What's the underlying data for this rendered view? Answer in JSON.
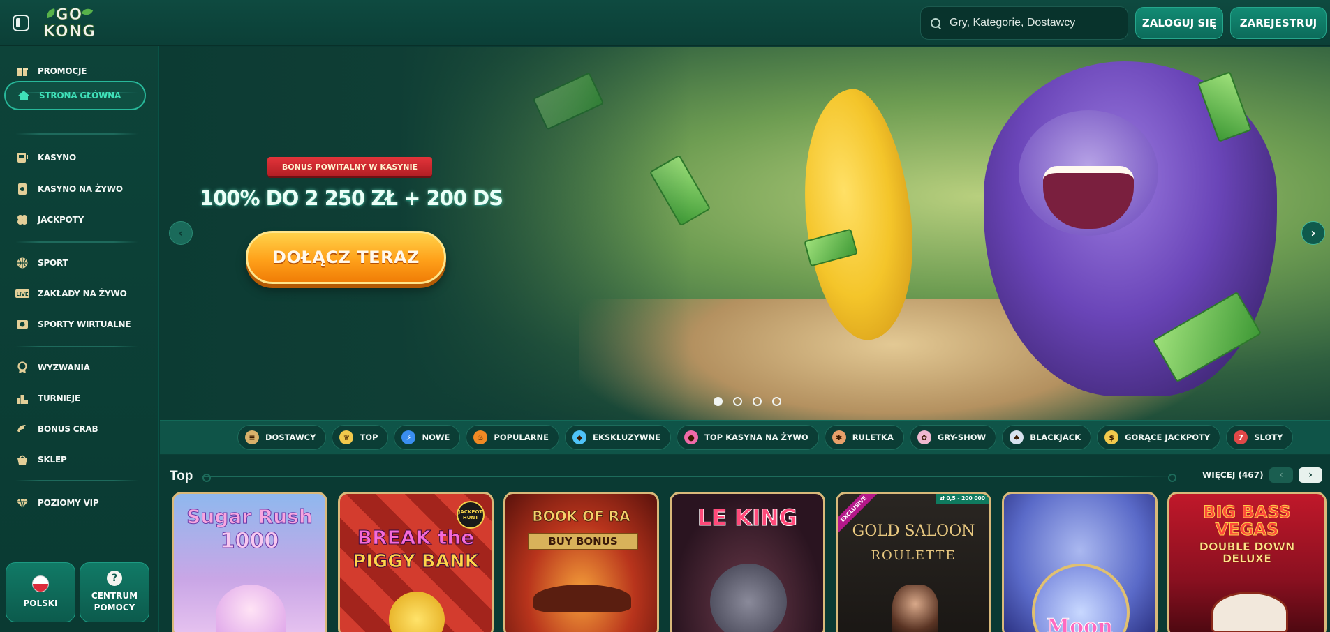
{
  "header": {
    "logo_top": "GO",
    "logo_bottom": "KONG",
    "search_placeholder": "Gry, Kategorie, Dostawcy",
    "login_label": "ZALOGUJ SIĘ",
    "register_label": "ZAREJESTRUJ"
  },
  "sidebar": {
    "items": [
      {
        "label": "PROMOCJE",
        "icon": "gift-icon"
      },
      {
        "label": "STRONA GŁÓWNA",
        "icon": "home-icon",
        "active": true
      },
      {
        "label": "KASYNO",
        "icon": "slot-machine-icon"
      },
      {
        "label": "KASYNO NA ŻYWO",
        "icon": "live-card-icon"
      },
      {
        "label": "JACKPOTY",
        "icon": "clover-icon"
      },
      {
        "label": "SPORT",
        "icon": "basketball-icon"
      },
      {
        "label": "ZAKŁADY NA ŻYWO",
        "icon": "live-badge-icon"
      },
      {
        "label": "SPORTY WIRTUALNE",
        "icon": "virtual-sport-icon"
      },
      {
        "label": "WYZWANIA",
        "icon": "medal-icon"
      },
      {
        "label": "TURNIEJE",
        "icon": "podium-icon"
      },
      {
        "label": "BONUS CRAB",
        "icon": "claw-icon"
      },
      {
        "label": "SKLEP",
        "icon": "basket-icon"
      },
      {
        "label": "POZIOMY VIP",
        "icon": "diamond-icon"
      }
    ],
    "language_label": "POLSKI",
    "help_label_1": "CENTRUM",
    "help_label_2": "POMOCY"
  },
  "hero": {
    "bonus_tag": "BONUS POWITALNY W KASYNIE",
    "headline": "100% DO 2 250 ZŁ + 200 DS",
    "cta": "DOŁĄCZ TERAZ",
    "slides_total": 4,
    "active_slide": 1
  },
  "categories": [
    {
      "label": "DOSTAWCY",
      "icon": "scroll-icon",
      "color": "#d9b16a"
    },
    {
      "label": "TOP",
      "icon": "crown-icon",
      "color": "#f2c94c"
    },
    {
      "label": "NOWE",
      "icon": "lightning-icon",
      "color": "#3a8ef0"
    },
    {
      "label": "POPULARNE",
      "icon": "fire-icon",
      "color": "#f08a24"
    },
    {
      "label": "EKSKLUZYWNE",
      "icon": "diamond-icon",
      "color": "#4fc3f7"
    },
    {
      "label": "TOP KASYNA NA ŻYWO",
      "icon": "chip-icon",
      "color": "#ef6aa8"
    },
    {
      "label": "RULETKA",
      "icon": "roulette-icon",
      "color": "#e8a06a"
    },
    {
      "label": "GRY-SHOW",
      "icon": "show-wheel-icon",
      "color": "#f0b8d0"
    },
    {
      "label": "BLACKJACK",
      "icon": "cards-icon",
      "color": "#d8e2ee"
    },
    {
      "label": "GORĄCE JACKPOTY",
      "icon": "coins-icon",
      "color": "#f2c94c"
    },
    {
      "label": "SLOTY",
      "icon": "slot-icon",
      "color": "#e04848"
    }
  ],
  "top_section": {
    "title": "Top",
    "more_label": "WIĘCEJ (467)"
  },
  "games": [
    {
      "title_1": "Sugar Rush",
      "title_2": "1000"
    },
    {
      "title_1": "BREAK the",
      "title_2": "PIGGY BANK",
      "badge": "JACKPOT HUNT"
    },
    {
      "title_1": "BOOK OF RA",
      "title_2": "BUY BONUS"
    },
    {
      "title_1": "LE KING",
      "title_2": ""
    },
    {
      "title_1": "GOLD SALOON",
      "title_2": "ROULETTE",
      "badge": "EXCLUSIVE",
      "range": "zł 0,5 - 200 000"
    },
    {
      "title_1": "Moon",
      "title_2": ""
    },
    {
      "title_1": "BIG BASS VEGAS",
      "title_2": "DOUBLE DOWN DELUXE"
    }
  ]
}
